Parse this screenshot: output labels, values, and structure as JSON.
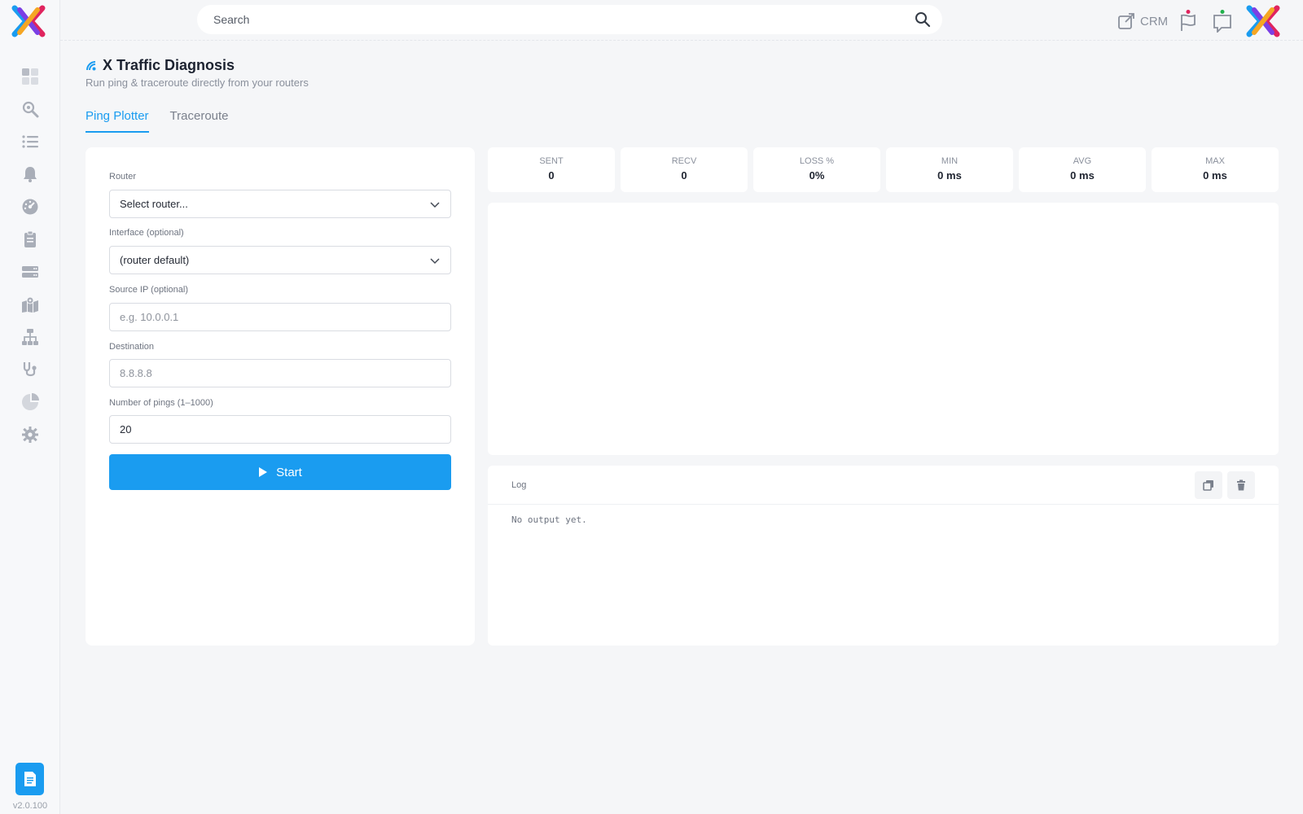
{
  "app": {
    "version": "v2.0.100"
  },
  "topbar": {
    "search_placeholder": "Search",
    "crm_label": "CRM",
    "flag_dot_color": "#e0245e",
    "chat_dot_color": "#22b14c"
  },
  "sidebar": {
    "items": [
      {
        "icon": "dashboard-icon"
      },
      {
        "icon": "search-zoom-icon"
      },
      {
        "icon": "list-icon"
      },
      {
        "icon": "bell-icon"
      },
      {
        "icon": "gauge-icon"
      },
      {
        "icon": "clipboard-icon"
      },
      {
        "icon": "server-icon"
      },
      {
        "icon": "map-icon"
      },
      {
        "icon": "network-icon"
      },
      {
        "icon": "stethoscope-icon"
      },
      {
        "icon": "pie-chart-icon"
      },
      {
        "icon": "gear-icon"
      }
    ]
  },
  "page": {
    "title": "X Traffic Diagnosis",
    "subtitle": "Run ping & traceroute directly from your routers"
  },
  "tabs": [
    {
      "label": "Ping Plotter",
      "active": true
    },
    {
      "label": "Traceroute",
      "active": false
    }
  ],
  "form": {
    "router_label": "Router",
    "router_value": "Select router...",
    "interface_label": "Interface (optional)",
    "interface_value": "(router default)",
    "source_ip_label": "Source IP (optional)",
    "source_ip_placeholder": "e.g. 10.0.0.1",
    "destination_label": "Destination",
    "destination_placeholder": "8.8.8.8",
    "pings_label": "Number of pings (1–1000)",
    "pings_value": "20",
    "start_label": "Start"
  },
  "stats": [
    {
      "label": "SENT",
      "value": "0"
    },
    {
      "label": "RECV",
      "value": "0"
    },
    {
      "label": "LOSS %",
      "value": "0%"
    },
    {
      "label": "MIN",
      "value": "0 ms"
    },
    {
      "label": "AVG",
      "value": "0 ms"
    },
    {
      "label": "MAX",
      "value": "0 ms"
    }
  ],
  "log": {
    "title": "Log",
    "output": "No output yet."
  },
  "colors": {
    "accent": "#1a9cf0",
    "sidebar_icon": "#a9aeb8"
  }
}
